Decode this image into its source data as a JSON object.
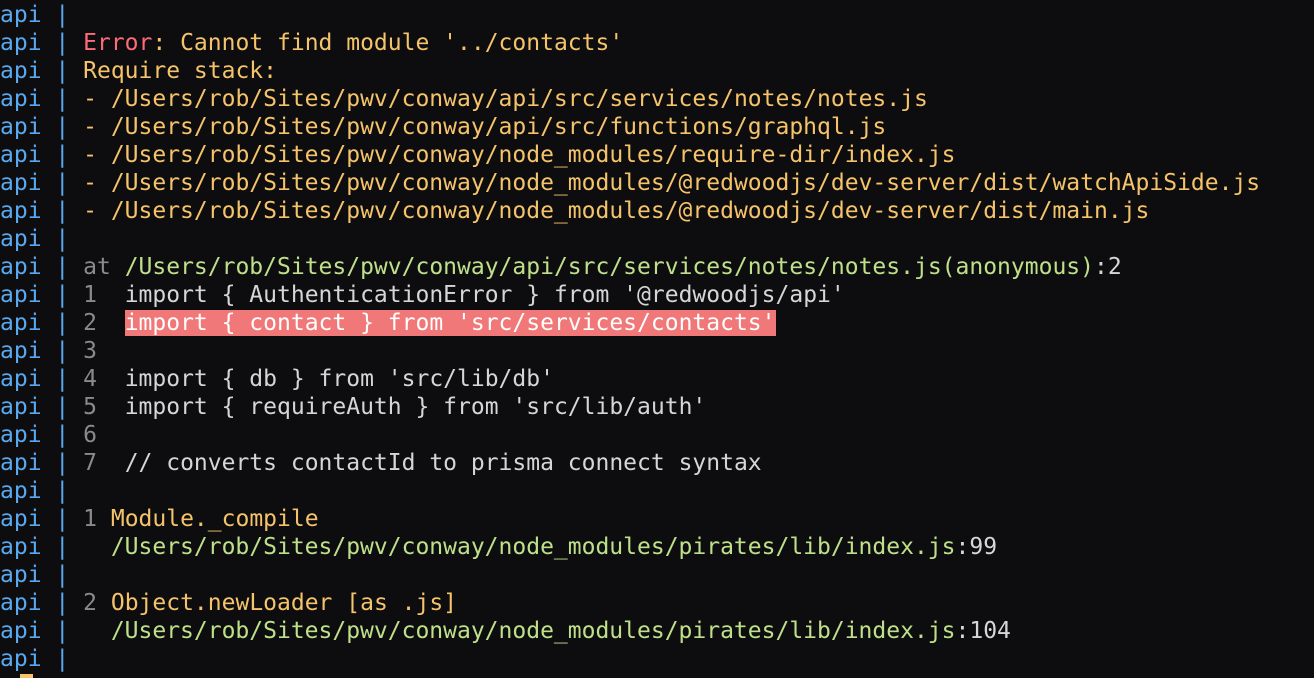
{
  "terminal": {
    "prefix": "api",
    "separator": "|",
    "lines": [
      {
        "type": "blank"
      },
      {
        "type": "error",
        "label": "Error",
        "message": ": Cannot find module '../contacts'"
      },
      {
        "type": "text",
        "text": "Require stack:"
      },
      {
        "type": "text",
        "text": "- /Users/rob/Sites/pwv/conway/api/src/services/notes/notes.js"
      },
      {
        "type": "text",
        "text": "- /Users/rob/Sites/pwv/conway/api/src/functions/graphql.js"
      },
      {
        "type": "text",
        "text": "- /Users/rob/Sites/pwv/conway/node_modules/require-dir/index.js"
      },
      {
        "type": "text",
        "text": "- /Users/rob/Sites/pwv/conway/node_modules/@redwoodjs/dev-server/dist/watchApiSide.js"
      },
      {
        "type": "text",
        "text": "- /Users/rob/Sites/pwv/conway/node_modules/@redwoodjs/dev-server/dist/main.js"
      },
      {
        "type": "blank"
      },
      {
        "type": "at",
        "keyword": "at",
        "path": "/Users/rob/Sites/pwv/conway/api/src/services/notes/notes.js(anonymous)",
        "suffix": ":2"
      },
      {
        "type": "code",
        "num": "1",
        "code": "import { AuthenticationError } from '@redwoodjs/api'"
      },
      {
        "type": "code-hl",
        "num": "2",
        "code": "import { contact } from 'src/services/contacts'"
      },
      {
        "type": "code",
        "num": "3",
        "code": ""
      },
      {
        "type": "code",
        "num": "4",
        "code": "import { db } from 'src/lib/db'"
      },
      {
        "type": "code",
        "num": "5",
        "code": "import { requireAuth } from 'src/lib/auth'"
      },
      {
        "type": "code",
        "num": "6",
        "code": ""
      },
      {
        "type": "code",
        "num": "7",
        "code": "// converts contactId to prisma connect syntax"
      },
      {
        "type": "blank"
      },
      {
        "type": "frame",
        "num": "1",
        "name": "Module._compile"
      },
      {
        "type": "framepath",
        "path": "/Users/rob/Sites/pwv/conway/node_modules/pirates/lib/index.js",
        "suffix": ":99"
      },
      {
        "type": "blank"
      },
      {
        "type": "frame",
        "num": "2",
        "name": "Object.newLoader [as .js]"
      },
      {
        "type": "framepath",
        "path": "/Users/rob/Sites/pwv/conway/node_modules/pirates/lib/index.js",
        "suffix": ":104"
      },
      {
        "type": "blank"
      }
    ]
  }
}
